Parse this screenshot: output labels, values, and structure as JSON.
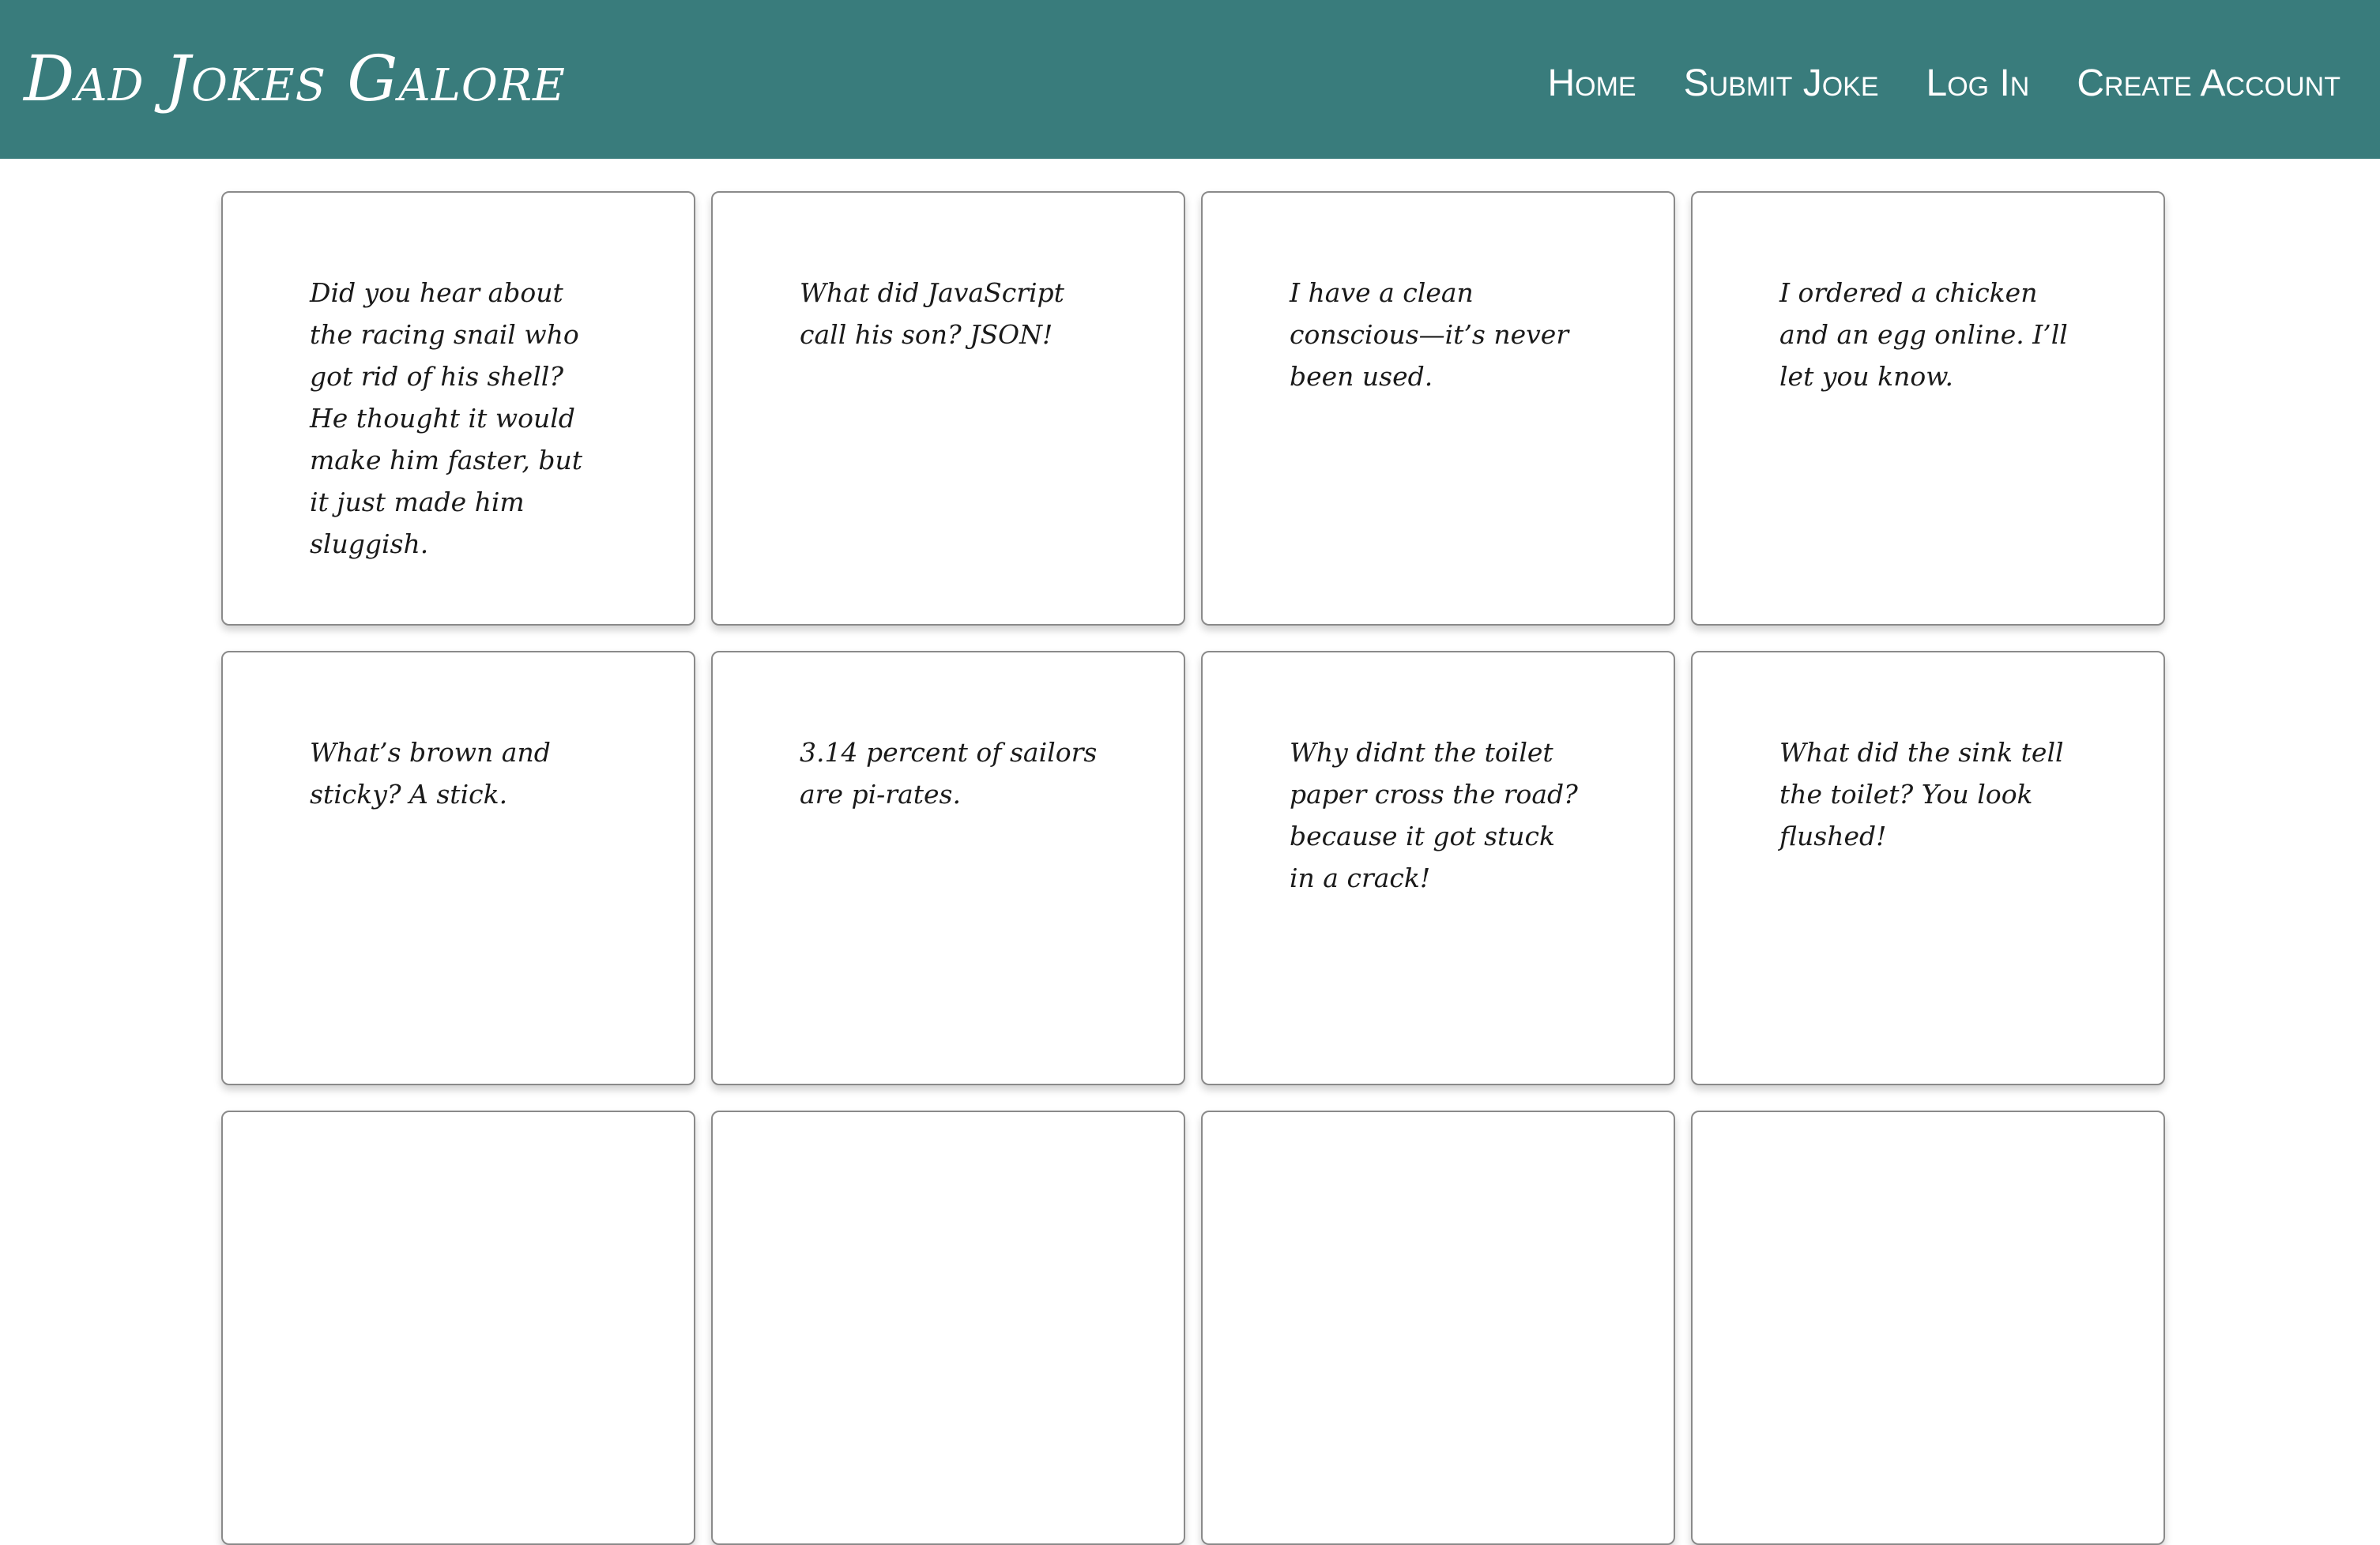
{
  "site": {
    "title": "Dad Jokes Galore"
  },
  "nav": {
    "items": [
      {
        "label": "Home"
      },
      {
        "label": "Submit Joke"
      },
      {
        "label": "Log In"
      },
      {
        "label": "Create Account"
      }
    ]
  },
  "jokes": [
    {
      "text": "Did you hear about the racing snail who got rid of his shell? He thought it would make him faster, but it just made him sluggish."
    },
    {
      "text": "What did JavaScript call his son? JSON!"
    },
    {
      "text": "I have a clean conscious—it’s never been used."
    },
    {
      "text": "I ordered a chicken and an egg online. I’ll let you know."
    },
    {
      "text": "What’s brown and sticky? A stick."
    },
    {
      "text": "3.14 percent of sailors are pi-rates."
    },
    {
      "text": "Why didnt the toilet paper cross the road? because it got stuck in a crack!"
    },
    {
      "text": "What did the sink tell the toilet? You look flushed!"
    },
    {
      "text": ""
    },
    {
      "text": ""
    },
    {
      "text": ""
    },
    {
      "text": ""
    }
  ]
}
